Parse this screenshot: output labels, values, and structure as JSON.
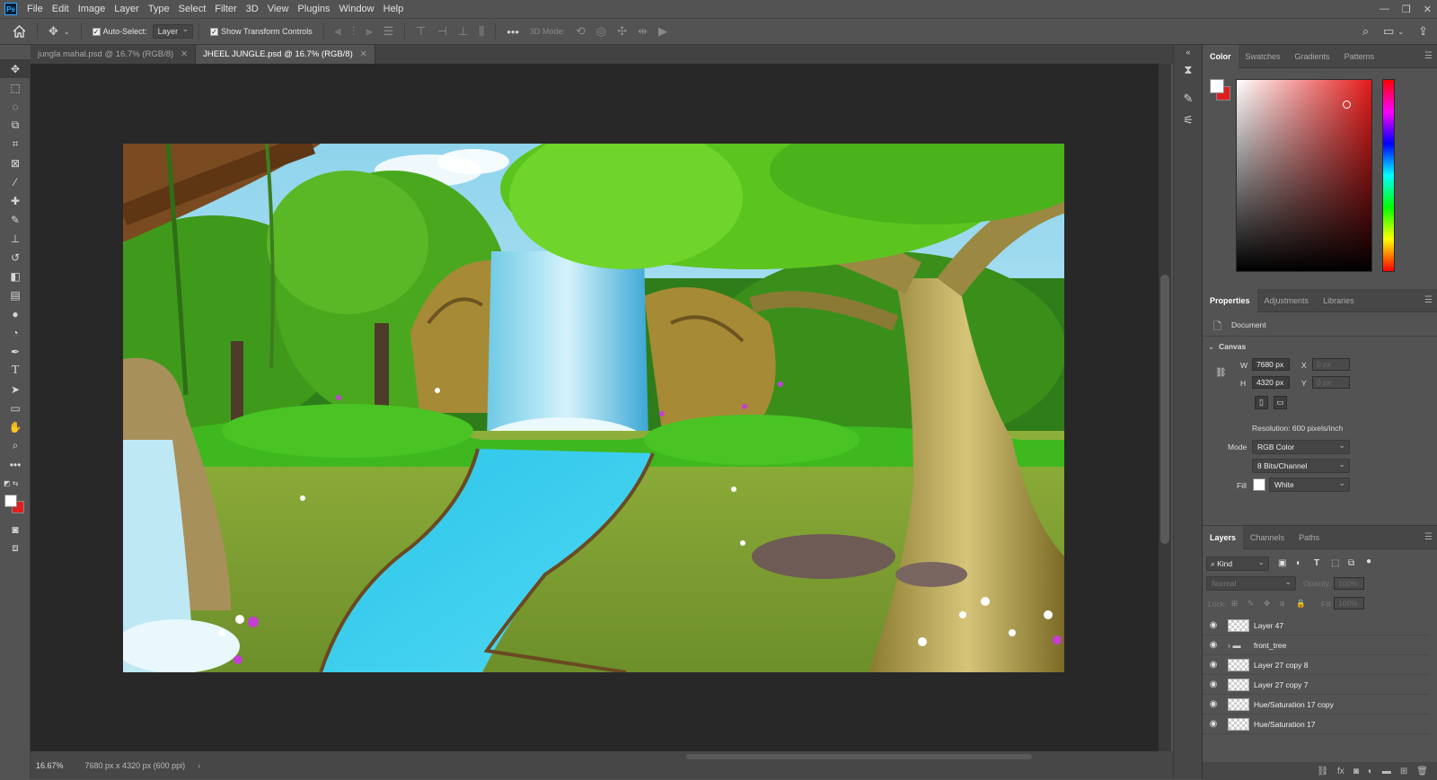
{
  "menubar": {
    "logo": "Ps",
    "items": [
      "File",
      "Edit",
      "Image",
      "Layer",
      "Type",
      "Select",
      "Filter",
      "3D",
      "View",
      "Plugins",
      "Window",
      "Help"
    ]
  },
  "options": {
    "auto_select_label": "Auto-Select:",
    "auto_select_value": "Layer",
    "show_transform_label": "Show Transform Controls",
    "mode_3d_label": "3D Mode:"
  },
  "tabs": [
    {
      "label": "jungla mahal.psd @ 16.7% (RGB/8)",
      "active": false
    },
    {
      "label": "JHEEL JUNGLE.psd @ 16.7% (RGB/8)",
      "active": true
    }
  ],
  "status": {
    "zoom": "16.67%",
    "doc_info": "7680 px x 4320 px (600 ppi)"
  },
  "color_panel": {
    "tabs": [
      "Color",
      "Swatches",
      "Gradients",
      "Patterns"
    ],
    "foreground": "#ffffff",
    "background": "#e02020"
  },
  "properties": {
    "tabs": [
      "Properties",
      "Adjustments",
      "Libraries"
    ],
    "doc_label": "Document",
    "canvas_section": "Canvas",
    "w_label": "W",
    "w_value": "7680 px",
    "h_label": "H",
    "h_value": "4320 px",
    "x_label": "X",
    "x_value": "0 px",
    "y_label": "Y",
    "y_value": "0 px",
    "resolution": "Resolution: 600 pixels/inch",
    "mode_label": "Mode",
    "mode_value": "RGB Color",
    "bits_value": "8 Bits/Channel",
    "fill_label": "Fill",
    "fill_value": "White"
  },
  "layers": {
    "tabs": [
      "Layers",
      "Channels",
      "Paths"
    ],
    "kind_label": "Kind",
    "blend_mode": "Normal",
    "opacity_label": "Opacity:",
    "opacity_value": "100%",
    "lock_label": "Lock:",
    "fill_label": "Fill:",
    "fill_value": "100%",
    "items": [
      {
        "name": "Layer 47",
        "type": "layer"
      },
      {
        "name": "front_tree",
        "type": "group"
      },
      {
        "name": "Layer 27 copy 8",
        "type": "layer"
      },
      {
        "name": "Layer 27 copy 7",
        "type": "layer"
      },
      {
        "name": "Hue/Saturation 17 copy",
        "type": "layer"
      },
      {
        "name": "Hue/Saturation 17",
        "type": "layer"
      }
    ]
  }
}
